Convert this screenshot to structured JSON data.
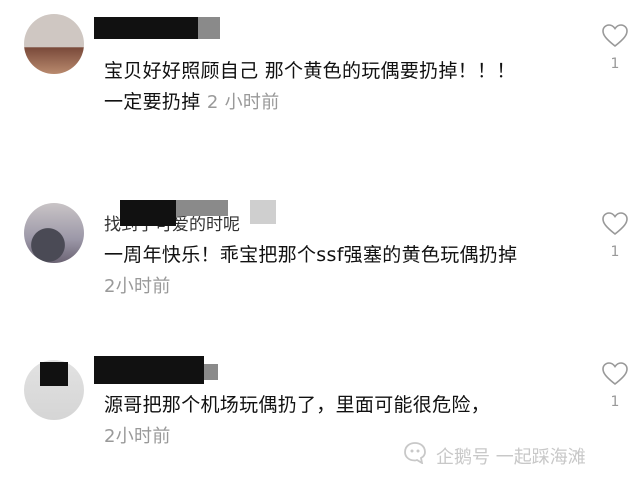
{
  "comments": [
    {
      "username": "",
      "text": "宝贝好好照顾自己 那个黄色的玩偶要扔掉！！！",
      "text2": "一定要扔掉",
      "time": "2 小时前",
      "likes": "1"
    },
    {
      "username": "找到了可爱的时呢",
      "text": "一周年快乐！乖宝把那个ssf强塞的黄色玩偶扔掉",
      "time": "2小时前",
      "likes": "1"
    },
    {
      "username": "",
      "text": "源哥把那个机场玩偶扔了，里面可能很危险，",
      "time": "2小时前",
      "likes": "1"
    }
  ],
  "watermark": {
    "text": "企鹅号 一起踩海滩",
    "icon": "penguin-logo-icon"
  },
  "colors": {
    "text": "#111111",
    "meta": "#999999",
    "heart": "#999999"
  }
}
